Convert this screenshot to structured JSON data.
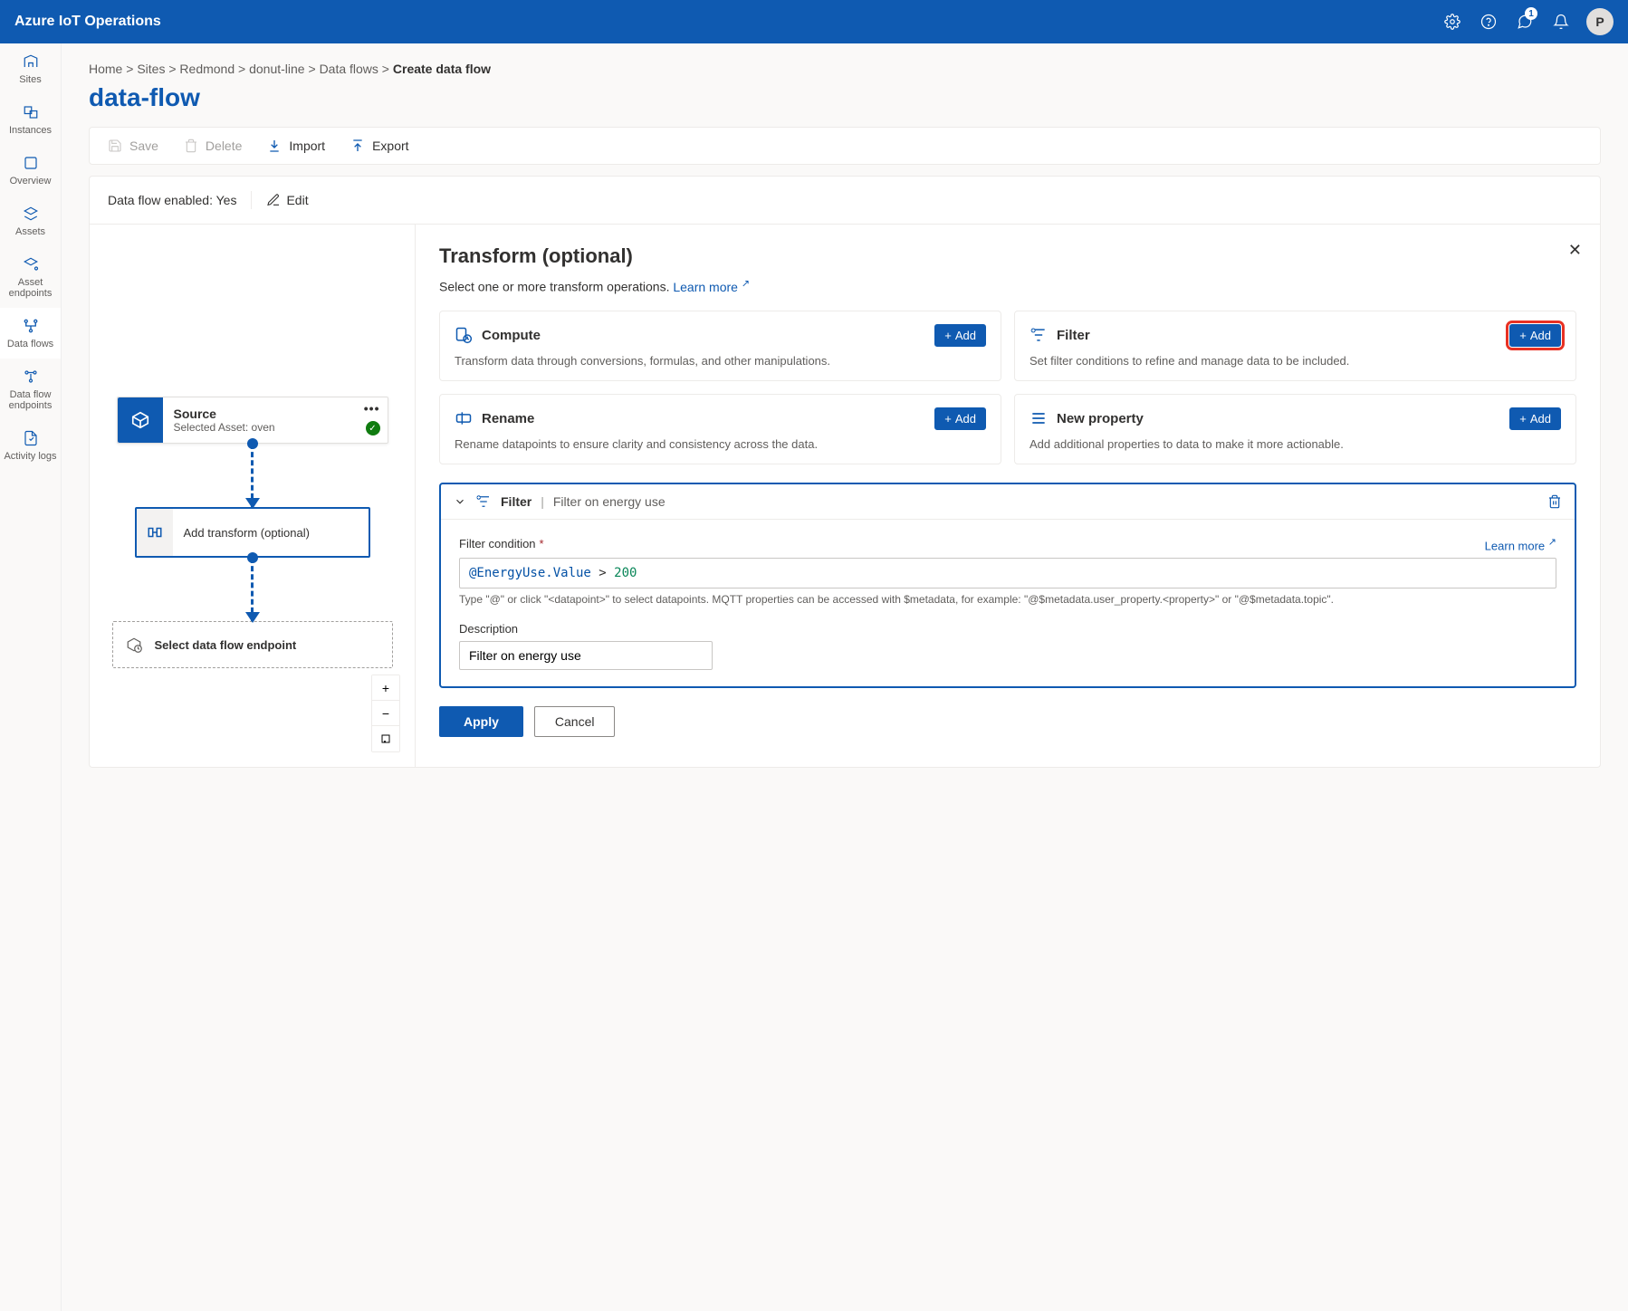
{
  "topbar": {
    "brand": "Azure IoT Operations",
    "notification_count": "1",
    "avatar_initial": "P"
  },
  "leftnav": {
    "items": [
      {
        "label": "Sites"
      },
      {
        "label": "Instances"
      },
      {
        "label": "Overview"
      },
      {
        "label": "Assets"
      },
      {
        "label": "Asset endpoints"
      },
      {
        "label": "Data flows"
      },
      {
        "label": "Data flow endpoints"
      },
      {
        "label": "Activity logs"
      }
    ]
  },
  "breadcrumb": {
    "items": [
      "Home",
      "Sites",
      "Redmond",
      "donut-line",
      "Data flows"
    ],
    "current": "Create data flow"
  },
  "page_title": "data-flow",
  "toolbar": {
    "save": "Save",
    "delete": "Delete",
    "import": "Import",
    "export": "Export"
  },
  "status": {
    "enabled_label": "Data flow enabled: ",
    "enabled_value": "Yes",
    "edit": "Edit"
  },
  "graph": {
    "source": {
      "title": "Source",
      "subtitle": "Selected Asset: oven"
    },
    "transform": {
      "label": "Add transform (optional)"
    },
    "endpoint": {
      "label": "Select data flow endpoint"
    }
  },
  "panel": {
    "title": "Transform (optional)",
    "subtitle": "Select one or more transform operations. ",
    "learn_more": "Learn more",
    "cards": [
      {
        "name": "Compute",
        "desc": "Transform data through conversions, formulas, and other manipulations.",
        "add": "Add"
      },
      {
        "name": "Filter",
        "desc": "Set filter conditions to refine and manage data to be included.",
        "add": "Add"
      },
      {
        "name": "Rename",
        "desc": "Rename datapoints to ensure clarity and consistency across the data.",
        "add": "Add"
      },
      {
        "name": "New property",
        "desc": "Add additional properties to data to make it more actionable.",
        "add": "Add"
      }
    ],
    "filter_block": {
      "name": "Filter",
      "desc": "Filter on energy use",
      "condition_label": "Filter condition",
      "condition_value": "@EnergyUse.Value > 200",
      "condition_help": "Type \"@\" or click \"<datapoint>\" to select datapoints. MQTT properties can be accessed with $metadata, for example: \"@$metadata.user_property.<property>\" or \"@$metadata.topic\".",
      "description_label": "Description",
      "description_value": "Filter on energy use",
      "learn_more": "Learn more"
    },
    "apply": "Apply",
    "cancel": "Cancel"
  }
}
